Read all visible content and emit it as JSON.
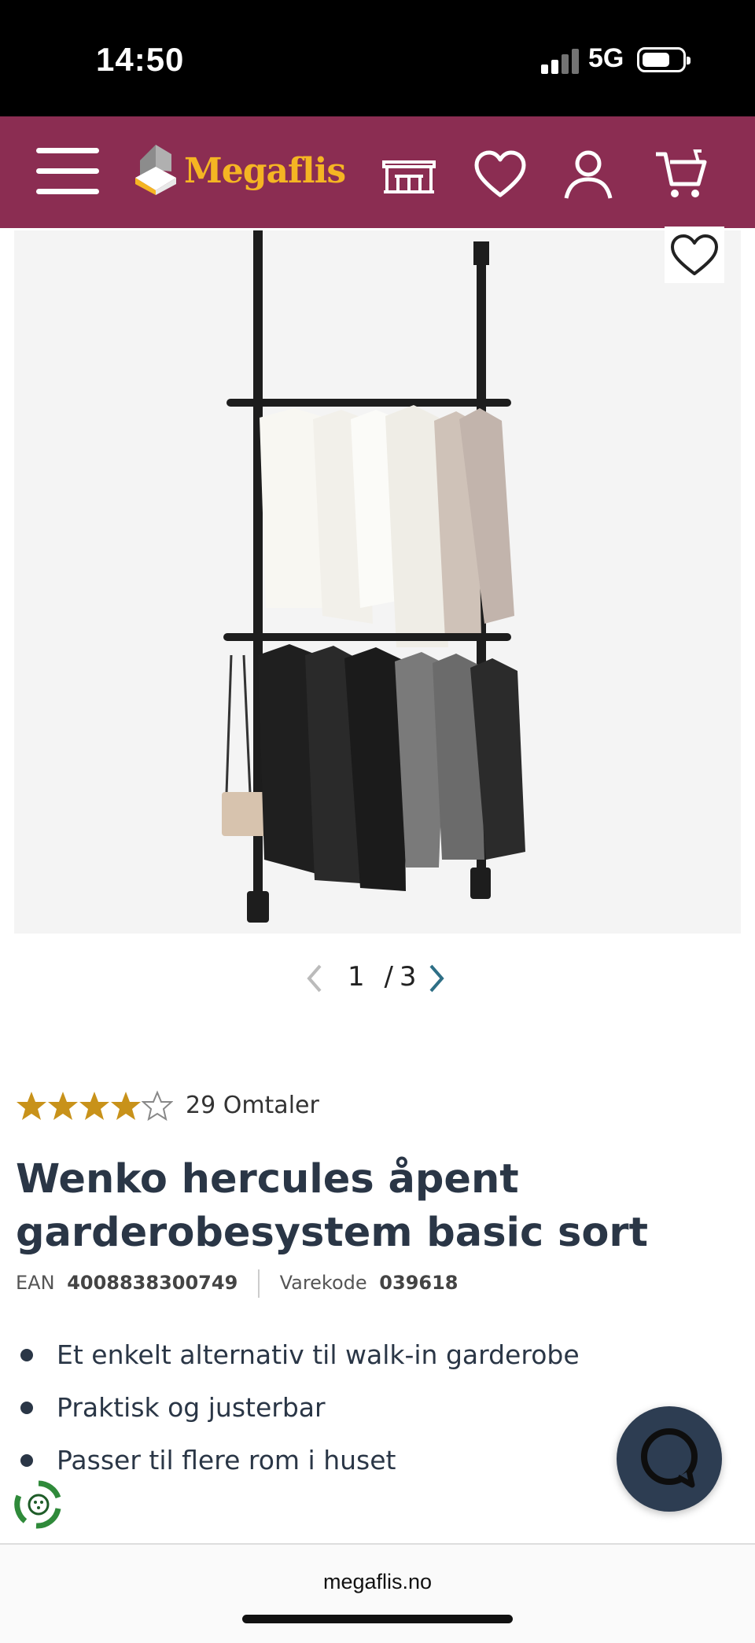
{
  "status_bar": {
    "time": "14:50",
    "network": "5G"
  },
  "header": {
    "brand": "Megaflis",
    "icons": [
      "menu-icon",
      "showroom-icon",
      "heart-icon",
      "user-icon",
      "cart-icon"
    ],
    "background": "#8b2d52",
    "accent": "#f5b523"
  },
  "gallery": {
    "current": "1",
    "separator": "/",
    "total": "3"
  },
  "product": {
    "rating": 4,
    "rating_max": 5,
    "reviews_label": "29 Omtaler",
    "title": "Wenko hercules åpent garderobesystem basic sort",
    "ean_label": "EAN",
    "ean_value": "4008838300749",
    "sku_label": "Varekode",
    "sku_value": "039618",
    "bullets": [
      "Et enkelt alternativ til walk-in garderobe",
      "Praktisk og justerbar",
      "Passer til flere rom i huset"
    ]
  },
  "browser": {
    "url": "megaflis.no"
  }
}
